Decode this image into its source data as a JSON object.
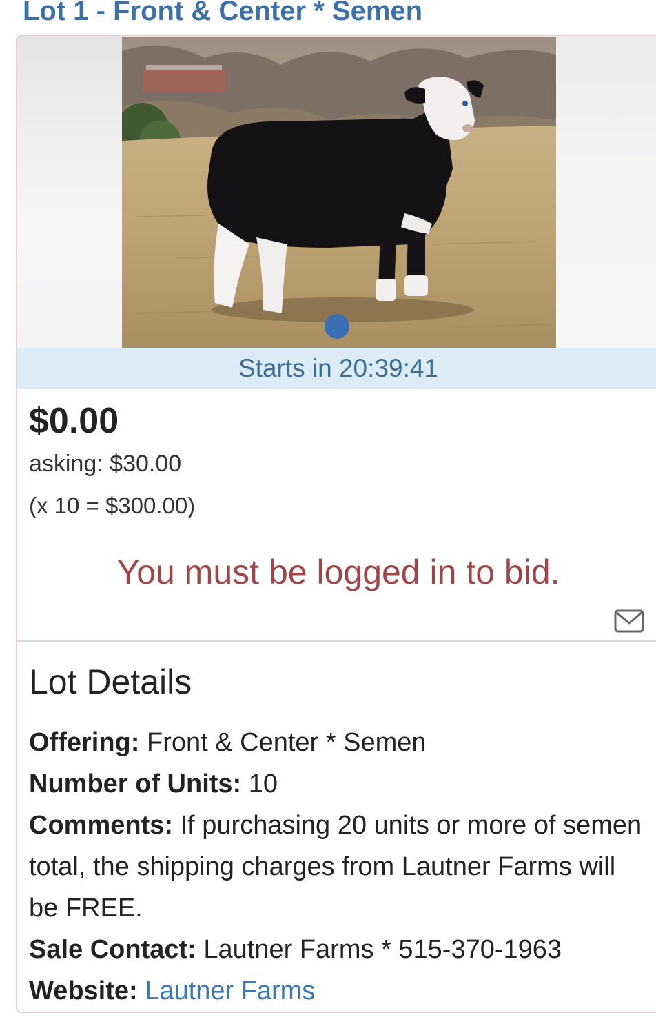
{
  "lot": {
    "title": "Lot 1 - Front & Center * Semen"
  },
  "photo": {
    "alt": "Front & Center"
  },
  "timer": {
    "text": "Starts in 20:39:41"
  },
  "bidding": {
    "current_price": "$0.00",
    "asking": "asking: $30.00",
    "multiplier": "(x 10 = $300.00)",
    "login_message": "You must be logged in to bid."
  },
  "details": {
    "heading": "Lot Details",
    "offering_label": "Offering:",
    "offering_value": "Front & Center * Semen",
    "units_label": "Number of Units:",
    "units_value": "10",
    "comments_label": "Comments:",
    "comments_value": "If purchasing 20 units or more of semen total, the shipping charges from Lautner Farms will be FREE.",
    "contact_label": "Sale Contact:",
    "contact_value": "Lautner Farms * 515-370-1963",
    "website_label": "Website:",
    "website_link": "Lautner Farms"
  },
  "icons": {
    "mail": "envelope-icon"
  },
  "colors": {
    "title_blue": "#3d6fa8",
    "timer_bg": "#dcecf6",
    "timer_text": "#3d6d95",
    "login_red": "#a04545",
    "link_blue": "#3a76b8",
    "dot_blue": "#3a6fb5"
  }
}
